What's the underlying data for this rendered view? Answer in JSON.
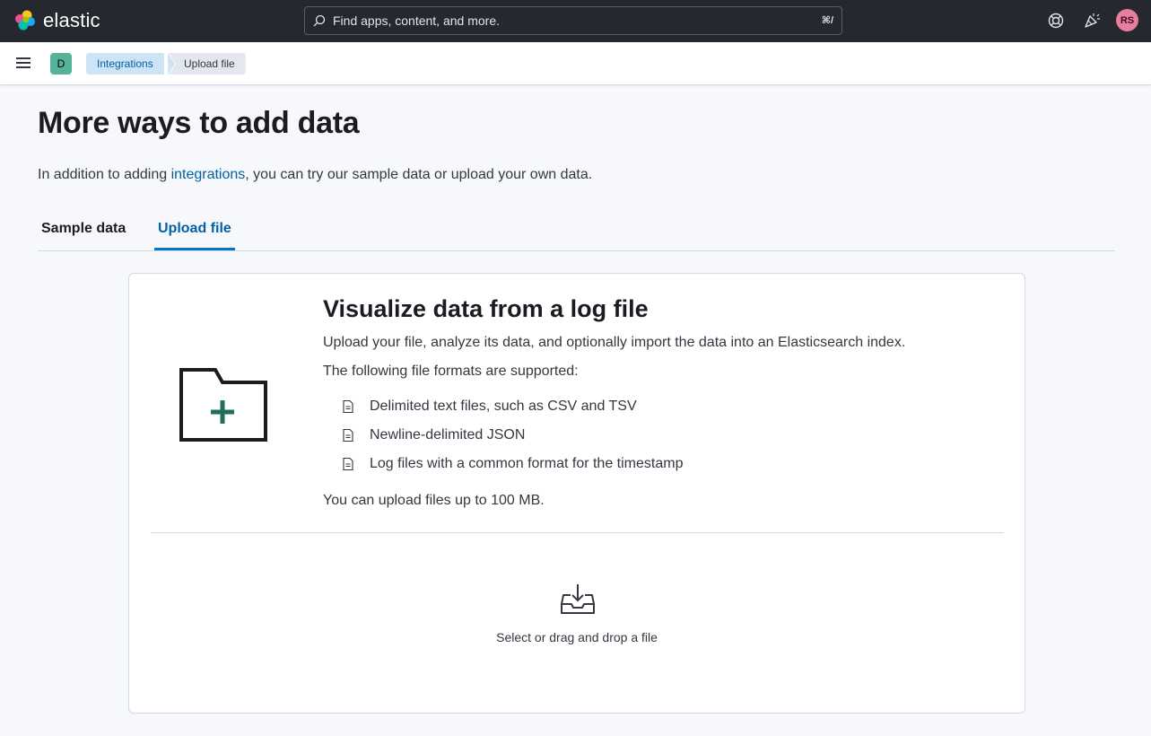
{
  "header": {
    "brand": "elastic",
    "search_placeholder": "Find apps, content, and more.",
    "search_shortcut": "⌘/",
    "avatar_initials": "RS"
  },
  "subheader": {
    "space_initial": "D",
    "breadcrumbs": [
      {
        "label": "Integrations"
      },
      {
        "label": "Upload file"
      }
    ]
  },
  "page": {
    "title": "More ways to add data",
    "intro_before": "In addition to adding ",
    "intro_link": "integrations",
    "intro_after": ", you can try our sample data or upload your own data.",
    "tabs": [
      {
        "label": "Sample data",
        "selected": false
      },
      {
        "label": "Upload file",
        "selected": true
      }
    ]
  },
  "panel": {
    "title": "Visualize data from a log file",
    "description": "Upload your file, analyze its data, and optionally import the data into an Elasticsearch index.",
    "formats_intro": "The following file formats are supported:",
    "formats": [
      "Delimited text files, such as CSV and TSV",
      "Newline-delimited JSON",
      "Log files with a common format for the timestamp"
    ],
    "limit": "You can upload files up to 100 MB.",
    "drop_label": "Select or drag and drop a file"
  },
  "icons": {
    "logo": "elastic-logo-icon",
    "search": "search-icon",
    "help": "help-lifebuoy-icon",
    "news": "newsfeed-cheer-icon",
    "menu": "hamburger-menu-icon",
    "folder": "folder-add-icon",
    "document": "document-icon",
    "upload": "file-import-icon"
  },
  "colors": {
    "header_bg": "#25282f",
    "link": "#0061a6",
    "avatar_bg": "#e77ea0",
    "space_badge_bg": "#54b399",
    "folder_plus": "#1f6f5c"
  }
}
